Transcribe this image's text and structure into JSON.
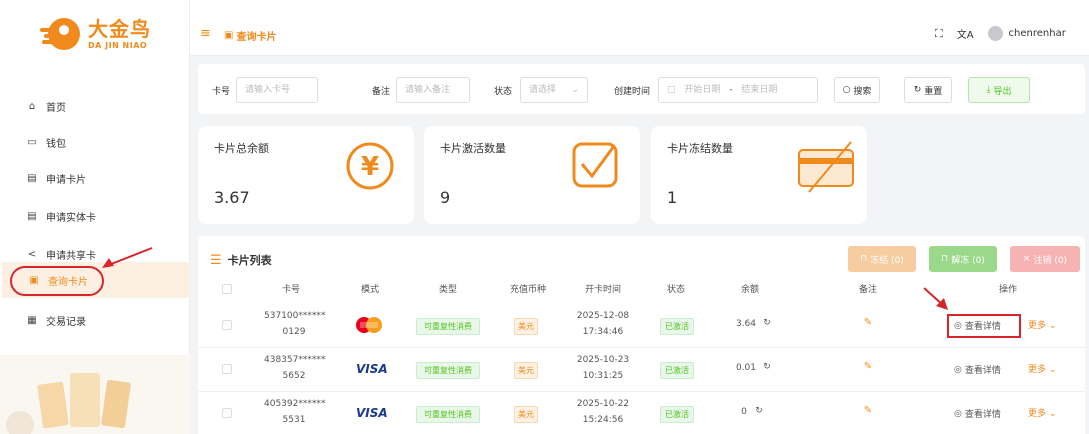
{
  "logo": {
    "cn": "大金鸟",
    "en": "DA JIN NIAO"
  },
  "sidebar": {
    "items": [
      {
        "label": "首页",
        "icon": "home-icon"
      },
      {
        "label": "钱包",
        "icon": "wallet-icon"
      },
      {
        "label": "申请卡片",
        "icon": "card-icon"
      },
      {
        "label": "申请实体卡",
        "icon": "card-icon"
      },
      {
        "label": "申请共享卡",
        "icon": "share-icon"
      },
      {
        "label": "查询卡片",
        "icon": "document-icon",
        "active": true
      },
      {
        "label": "交易记录",
        "icon": "records-icon"
      }
    ]
  },
  "header": {
    "breadcrumb": "查询卡片",
    "username": "chenrenhar"
  },
  "filter": {
    "card_no_label": "卡号",
    "card_no_placeholder": "请输入卡号",
    "remark_label": "备注",
    "remark_placeholder": "请输入备注",
    "status_label": "状态",
    "status_placeholder": "请选择",
    "created_label": "创建时间",
    "start_placeholder": "开始日期",
    "date_sep": "-",
    "end_placeholder": "结束日期",
    "search_label": "搜索",
    "reset_label": "重置",
    "export_label": "导出"
  },
  "stats": [
    {
      "title": "卡片总余额",
      "value": "3.67"
    },
    {
      "title": "卡片激活数量",
      "value": "9"
    },
    {
      "title": "卡片冻结数量",
      "value": "1"
    }
  ],
  "table": {
    "title": "卡片列表",
    "freeze_label": "冻结 (0)",
    "unfreeze_label": "解冻 (0)",
    "cancel_label": "注销 (0)",
    "columns": [
      "卡号",
      "模式",
      "类型",
      "充值币种",
      "开卡时间",
      "状态",
      "余额",
      "备注",
      "操作"
    ],
    "rows": [
      {
        "card_top": "537100******",
        "card_bottom": "0129",
        "brand": "mastercard",
        "type": "可重复性消费",
        "currency": "美元",
        "date": "2025-12-08",
        "time": "17:34:46",
        "status": "已激活",
        "balance": "3.64"
      },
      {
        "card_top": "438357******",
        "card_bottom": "5652",
        "brand": "VISA",
        "type": "可重复性消费",
        "currency": "美元",
        "date": "2025-10-23",
        "time": "10:31:25",
        "status": "已激活",
        "balance": "0.01"
      },
      {
        "card_top": "405392******",
        "card_bottom": "5531",
        "brand": "VISA",
        "type": "可重复性消费",
        "currency": "美元",
        "date": "2025-10-22",
        "time": "15:24:56",
        "status": "已激活",
        "balance": "0"
      }
    ],
    "detail_label": "查看详情",
    "more_label": "更多"
  },
  "colors": {
    "accent": "#f08a1c",
    "green": "#52c41a",
    "annotation_red": "#d6262c"
  }
}
